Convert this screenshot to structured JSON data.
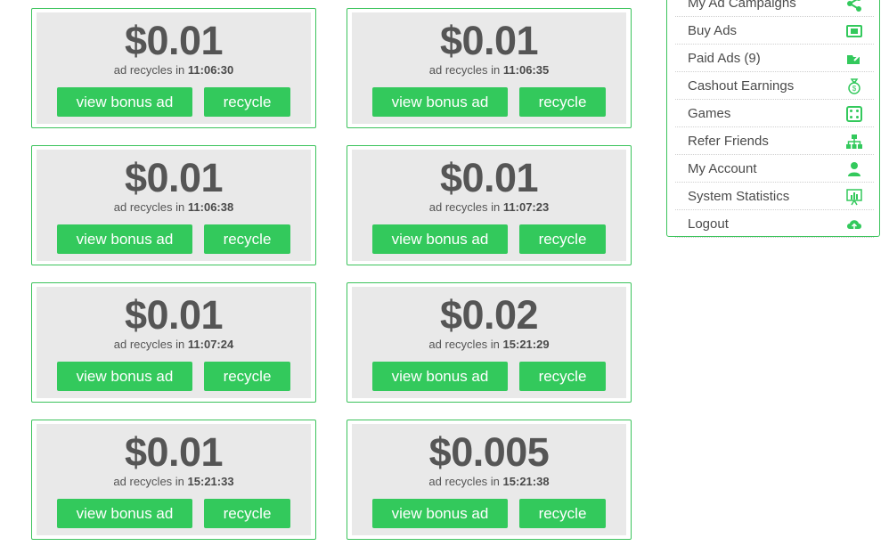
{
  "ads": [
    {
      "price": "$0.01",
      "recycle_prefix": "ad recycles in",
      "recycle_time": "11:06:30",
      "bonus_label": "view bonus ad",
      "recycle_label": "recycle"
    },
    {
      "price": "$0.01",
      "recycle_prefix": "ad recycles in",
      "recycle_time": "11:06:35",
      "bonus_label": "view bonus ad",
      "recycle_label": "recycle"
    },
    {
      "price": "$0.01",
      "recycle_prefix": "ad recycles in",
      "recycle_time": "11:06:38",
      "bonus_label": "view bonus ad",
      "recycle_label": "recycle"
    },
    {
      "price": "$0.01",
      "recycle_prefix": "ad recycles in",
      "recycle_time": "11:07:23",
      "bonus_label": "view bonus ad",
      "recycle_label": "recycle"
    },
    {
      "price": "$0.01",
      "recycle_prefix": "ad recycles in",
      "recycle_time": "11:07:24",
      "bonus_label": "view bonus ad",
      "recycle_label": "recycle"
    },
    {
      "price": "$0.02",
      "recycle_prefix": "ad recycles in",
      "recycle_time": "15:21:29",
      "bonus_label": "view bonus ad",
      "recycle_label": "recycle"
    },
    {
      "price": "$0.01",
      "recycle_prefix": "ad recycles in",
      "recycle_time": "15:21:33",
      "bonus_label": "view bonus ad",
      "recycle_label": "recycle"
    },
    {
      "price": "$0.005",
      "recycle_prefix": "ad recycles in",
      "recycle_time": "15:21:38",
      "bonus_label": "view bonus ad",
      "recycle_label": "recycle"
    }
  ],
  "menu": {
    "items": [
      {
        "label": "My Ad Campaigns",
        "icon": "share-icon"
      },
      {
        "label": "Buy Ads",
        "icon": "cash-icon"
      },
      {
        "label": "Paid Ads (9)",
        "icon": "folder-arrow-icon"
      },
      {
        "label": "Cashout Earnings",
        "icon": "money-bag-icon"
      },
      {
        "label": "Games",
        "icon": "dice-icon"
      },
      {
        "label": "Refer Friends",
        "icon": "network-icon"
      },
      {
        "label": "My Account",
        "icon": "user-icon"
      },
      {
        "label": "System Statistics",
        "icon": "chart-board-icon"
      },
      {
        "label": "Logout",
        "icon": "cloud-upload-icon"
      }
    ]
  },
  "colors": {
    "accent_green": "#33c95c",
    "card_border": "#3cc35c",
    "card_background": "#e9e9e9",
    "text_dark": "#555555"
  }
}
